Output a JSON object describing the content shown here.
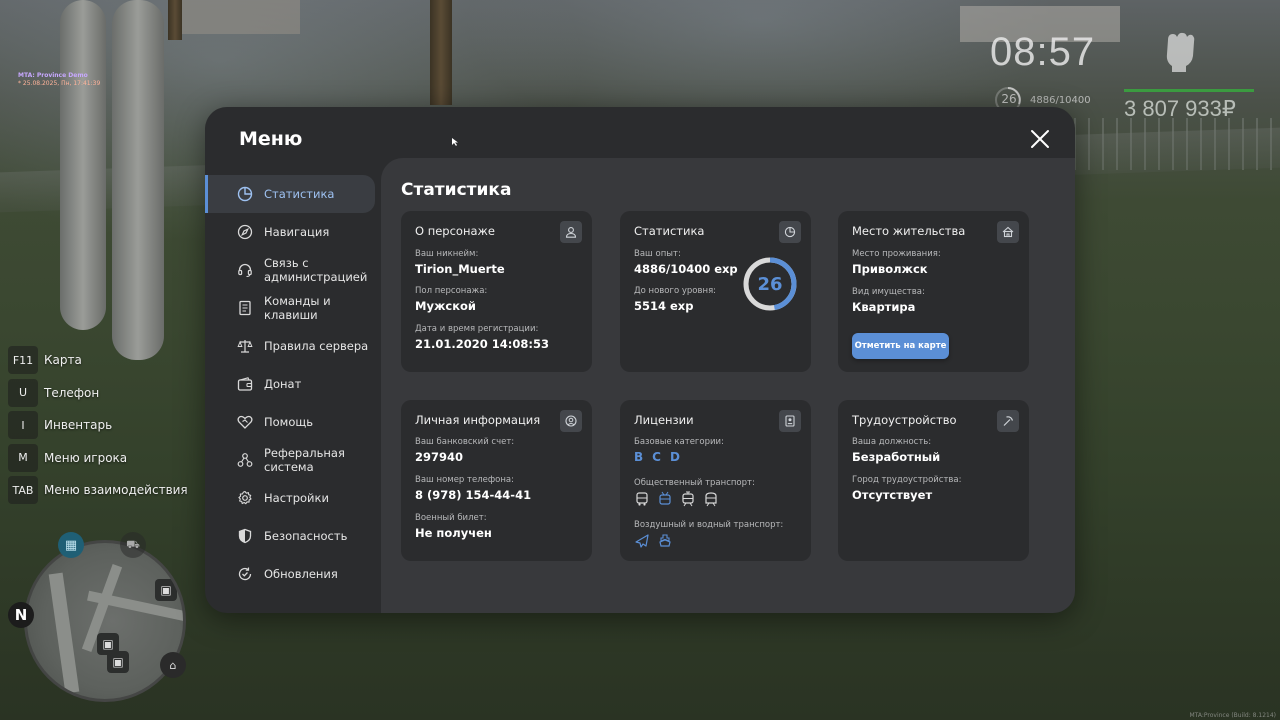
{
  "debug": {
    "server": "MTA: Province Demo",
    "datetime": "* 25.08.2025, Пн, 17:41:39"
  },
  "hud": {
    "clock": "08:57",
    "level": "26",
    "exp": "4886/10400",
    "money": "3 807 933₽"
  },
  "hotkeys": [
    {
      "key": "F11",
      "label": "Карта"
    },
    {
      "key": "U",
      "label": "Телефон"
    },
    {
      "key": "I",
      "label": "Инвентарь"
    },
    {
      "key": "M",
      "label": "Меню игрока"
    },
    {
      "key": "TAB",
      "label": "Меню взаимодействия"
    }
  ],
  "minimap": {
    "north": "N"
  },
  "footer": {
    "build": "MTA:Province (Build: 8.1214)"
  },
  "menu": {
    "title": "Меню",
    "content_title": "Статистика",
    "nav": [
      {
        "label": "Статистика",
        "icon": "pie-chart-icon"
      },
      {
        "label": "Навигация",
        "icon": "compass-icon"
      },
      {
        "label": "Связь с администрацией",
        "icon": "headset-icon"
      },
      {
        "label": "Команды и клавиши",
        "icon": "document-icon"
      },
      {
        "label": "Правила сервера",
        "icon": "scales-icon"
      },
      {
        "label": "Донат",
        "icon": "wallet-icon"
      },
      {
        "label": "Помощь",
        "icon": "heart-handshake-icon"
      },
      {
        "label": "Реферальная система",
        "icon": "network-icon"
      },
      {
        "label": "Настройки",
        "icon": "gear-icon"
      },
      {
        "label": "Безопасность",
        "icon": "shield-icon"
      },
      {
        "label": "Обновления",
        "icon": "refresh-check-icon"
      }
    ],
    "cards": {
      "character": {
        "title": "О персонаже",
        "nickname_label": "Ваш никнейм:",
        "nickname": "Tirion_Muerte",
        "gender_label": "Пол персонажа:",
        "gender": "Мужской",
        "reg_label": "Дата и время регистрации:",
        "reg": "21.01.2020 14:08:53"
      },
      "stats": {
        "title": "Статистика",
        "exp_label": "Ваш опыт:",
        "exp": "4886/10400 exp",
        "next_label": "До нового уровня:",
        "next": "5514 exp",
        "level": "26",
        "progress": 0.47
      },
      "residence": {
        "title": "Место жительства",
        "place_label": "Место проживания:",
        "place": "Приволжск",
        "property_label": "Вид имущества:",
        "property": "Квартира",
        "button": "Отметить на карте"
      },
      "personal": {
        "title": "Личная информация",
        "bank_label": "Ваш банковский счет:",
        "bank": "297940",
        "phone_label": "Ваш номер телефона:",
        "phone": "8 (978) 154-44-41",
        "military_label": "Военный билет:",
        "military": "Не получен"
      },
      "licenses": {
        "title": "Лицензии",
        "base_label": "Базовые категории:",
        "base": [
          "B",
          "C",
          "D"
        ],
        "public_label": "Общественный транспорт:",
        "air_label": "Воздушный и водный транспорт:"
      },
      "employment": {
        "title": "Трудоустройство",
        "position_label": "Ваша должность:",
        "position": "Безработный",
        "city_label": "Город трудоустройства:",
        "city": "Отсутствует"
      }
    }
  },
  "colors": {
    "accent": "#5b8fd6",
    "panel": "#2b2c2e",
    "content": "#38393c",
    "money_bar": "#3b9b40"
  }
}
